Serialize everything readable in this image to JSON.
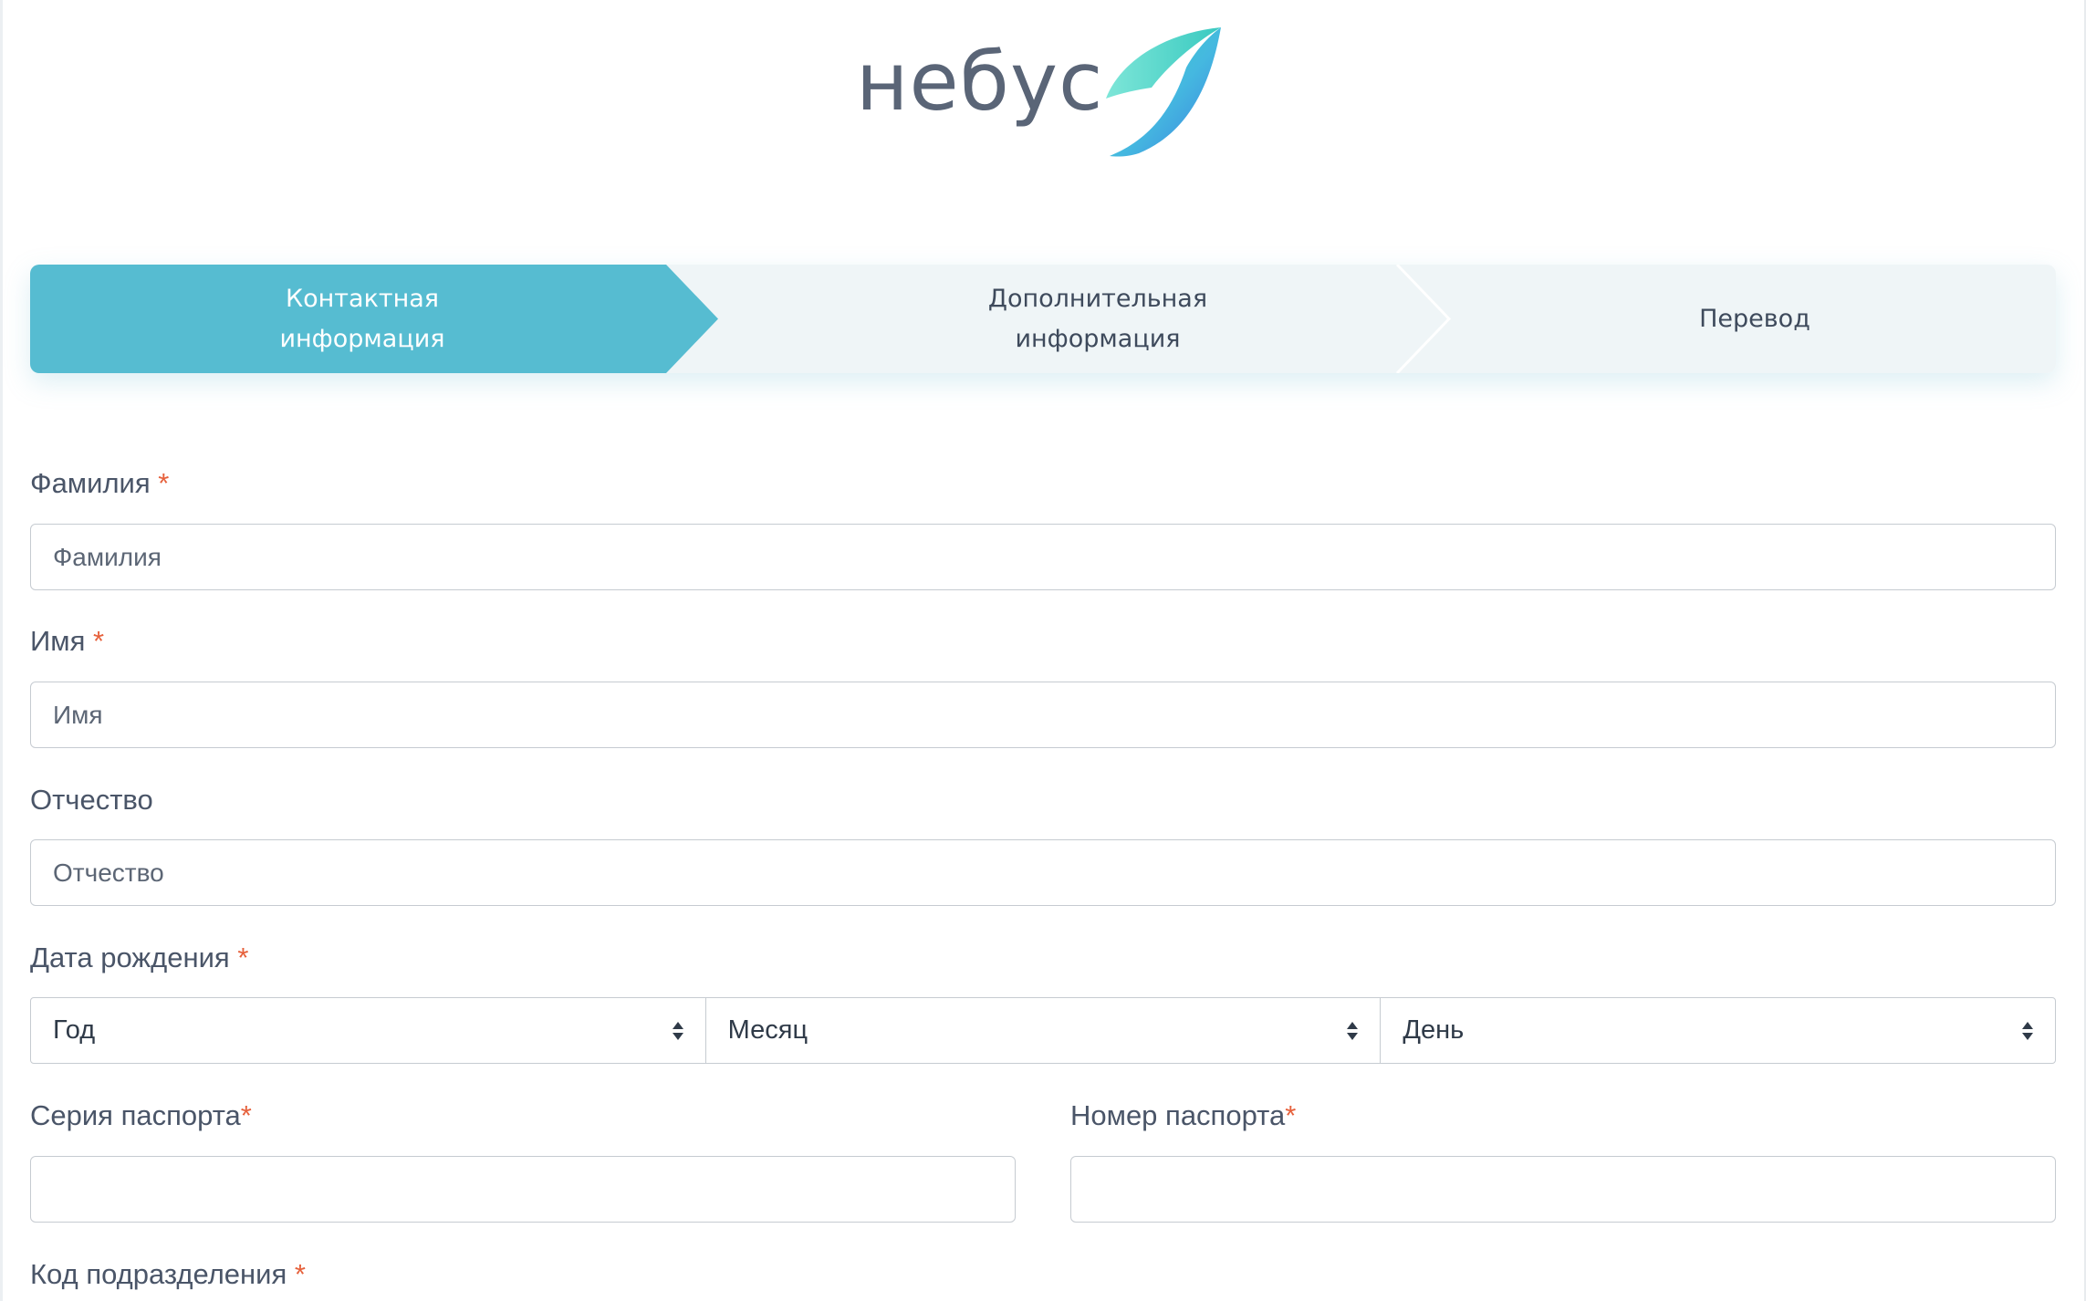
{
  "brand": {
    "name": "небус",
    "accent": "#56bcd1"
  },
  "steps": [
    {
      "label": "Контактная\nинформация",
      "active": true
    },
    {
      "label": "Дополнительная\nинформация",
      "active": false
    },
    {
      "label": "Перевод",
      "active": false
    }
  ],
  "form": {
    "required_mark": "*",
    "last_name": {
      "label": "Фамилия",
      "placeholder": "Фамилия"
    },
    "first_name": {
      "label": "Имя",
      "placeholder": "Имя"
    },
    "patronymic": {
      "label": "Отчество",
      "placeholder": "Отчество"
    },
    "birth_date": {
      "label": "Дата рождения",
      "year": "Год",
      "month": "Месяц",
      "day": "День"
    },
    "passport_series": {
      "label": "Серия паспорта"
    },
    "passport_number": {
      "label": "Номер паспорта"
    },
    "division_code": {
      "label": "Код подразделения"
    }
  },
  "colors": {
    "step_active": "#56bcd1",
    "step_inactive": "#eff5f7",
    "required": "#e6613c"
  }
}
